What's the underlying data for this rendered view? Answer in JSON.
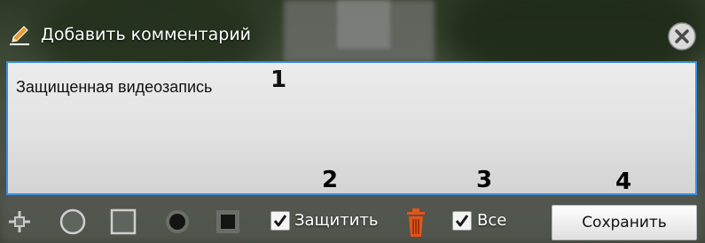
{
  "dialog": {
    "title": "Добавить комментарий",
    "icon": "pencil-icon",
    "close_icon": "close-icon"
  },
  "comment": {
    "value": "Защищенная видеозапись"
  },
  "callouts": [
    "1",
    "2",
    "3",
    "4"
  ],
  "toolbar": {
    "tools": [
      "crosshair-icon",
      "circle-outline-icon",
      "square-outline-icon",
      "circle-filled-icon",
      "square-filled-icon"
    ],
    "protect": {
      "label": "Защитить",
      "checked": true
    },
    "delete_icon": "trash-icon",
    "all": {
      "label": "Все",
      "checked": true
    },
    "save_label": "Сохранить"
  },
  "colors": {
    "accent_border": "#3b8fe0",
    "trash": "#e2541c",
    "title_text": "#ffffff"
  }
}
